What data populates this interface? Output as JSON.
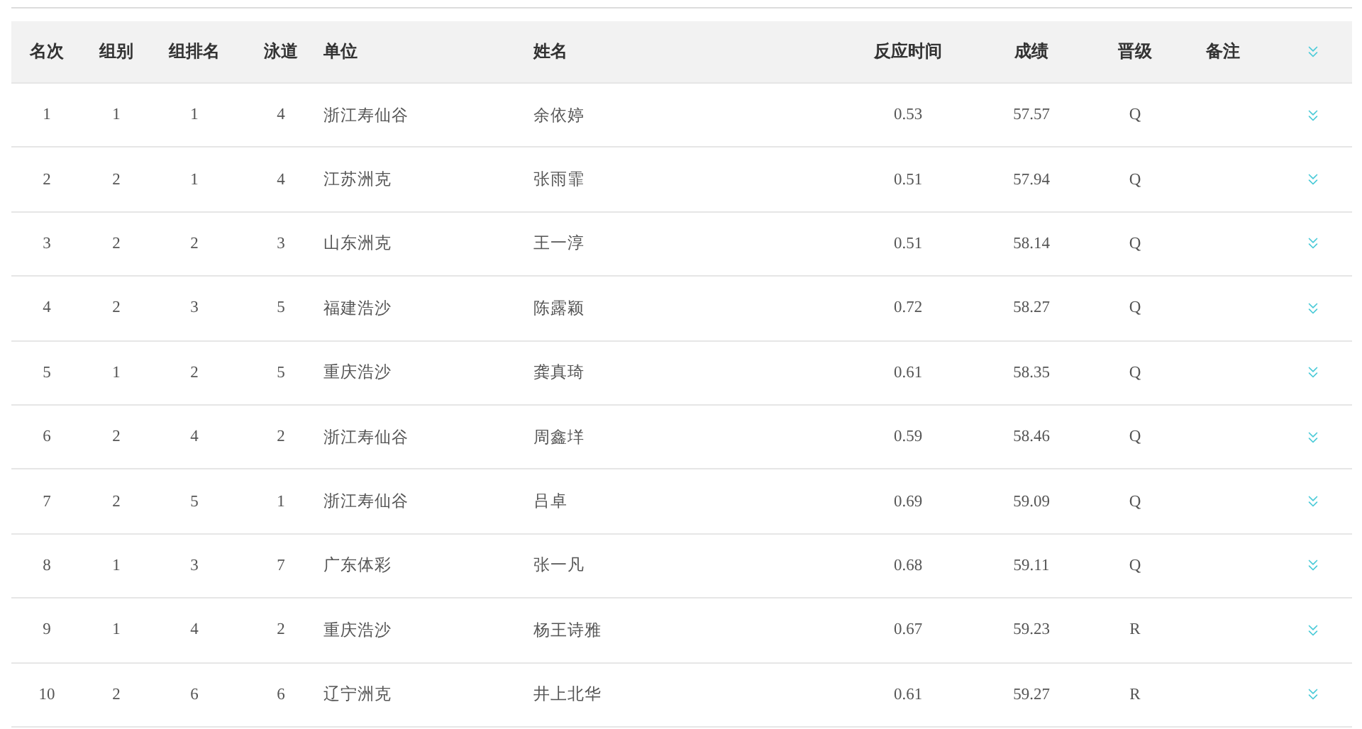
{
  "table": {
    "columns": [
      "名次",
      "组别",
      "组排名",
      "泳道",
      "单位",
      "姓名",
      "反应时间",
      "成绩",
      "晋级",
      "备注"
    ],
    "rows": [
      {
        "rank": "1",
        "group": "1",
        "group_rank": "1",
        "lane": "4",
        "team": "浙江寿仙谷",
        "name": "余依婷",
        "reaction": "0.53",
        "time": "57.57",
        "qualify": "Q"
      },
      {
        "rank": "2",
        "group": "2",
        "group_rank": "1",
        "lane": "4",
        "team": "江苏洲克",
        "name": "张雨霏",
        "reaction": "0.51",
        "time": "57.94",
        "qualify": "Q"
      },
      {
        "rank": "3",
        "group": "2",
        "group_rank": "2",
        "lane": "3",
        "team": "山东洲克",
        "name": "王一淳",
        "reaction": "0.51",
        "time": "58.14",
        "qualify": "Q"
      },
      {
        "rank": "4",
        "group": "2",
        "group_rank": "3",
        "lane": "5",
        "team": "福建浩沙",
        "name": "陈露颖",
        "reaction": "0.72",
        "time": "58.27",
        "qualify": "Q"
      },
      {
        "rank": "5",
        "group": "1",
        "group_rank": "2",
        "lane": "5",
        "team": "重庆浩沙",
        "name": "龚真琦",
        "reaction": "0.61",
        "time": "58.35",
        "qualify": "Q"
      },
      {
        "rank": "6",
        "group": "2",
        "group_rank": "4",
        "lane": "2",
        "team": "浙江寿仙谷",
        "name": "周鑫垟",
        "reaction": "0.59",
        "time": "58.46",
        "qualify": "Q"
      },
      {
        "rank": "7",
        "group": "2",
        "group_rank": "5",
        "lane": "1",
        "team": "浙江寿仙谷",
        "name": "吕卓",
        "reaction": "0.69",
        "time": "59.09",
        "qualify": "Q"
      },
      {
        "rank": "8",
        "group": "1",
        "group_rank": "3",
        "lane": "7",
        "team": "广东体彩",
        "name": "张一凡",
        "reaction": "0.68",
        "time": "59.11",
        "qualify": "Q"
      },
      {
        "rank": "9",
        "group": "1",
        "group_rank": "4",
        "lane": "2",
        "team": "重庆浩沙",
        "name": "杨王诗雅",
        "reaction": "0.67",
        "time": "59.23",
        "qualify": "R"
      },
      {
        "rank": "10",
        "group": "2",
        "group_rank": "6",
        "lane": "6",
        "team": "辽宁洲克",
        "name": "井上北华",
        "reaction": "0.61",
        "time": "59.27",
        "qualify": "R"
      }
    ]
  }
}
